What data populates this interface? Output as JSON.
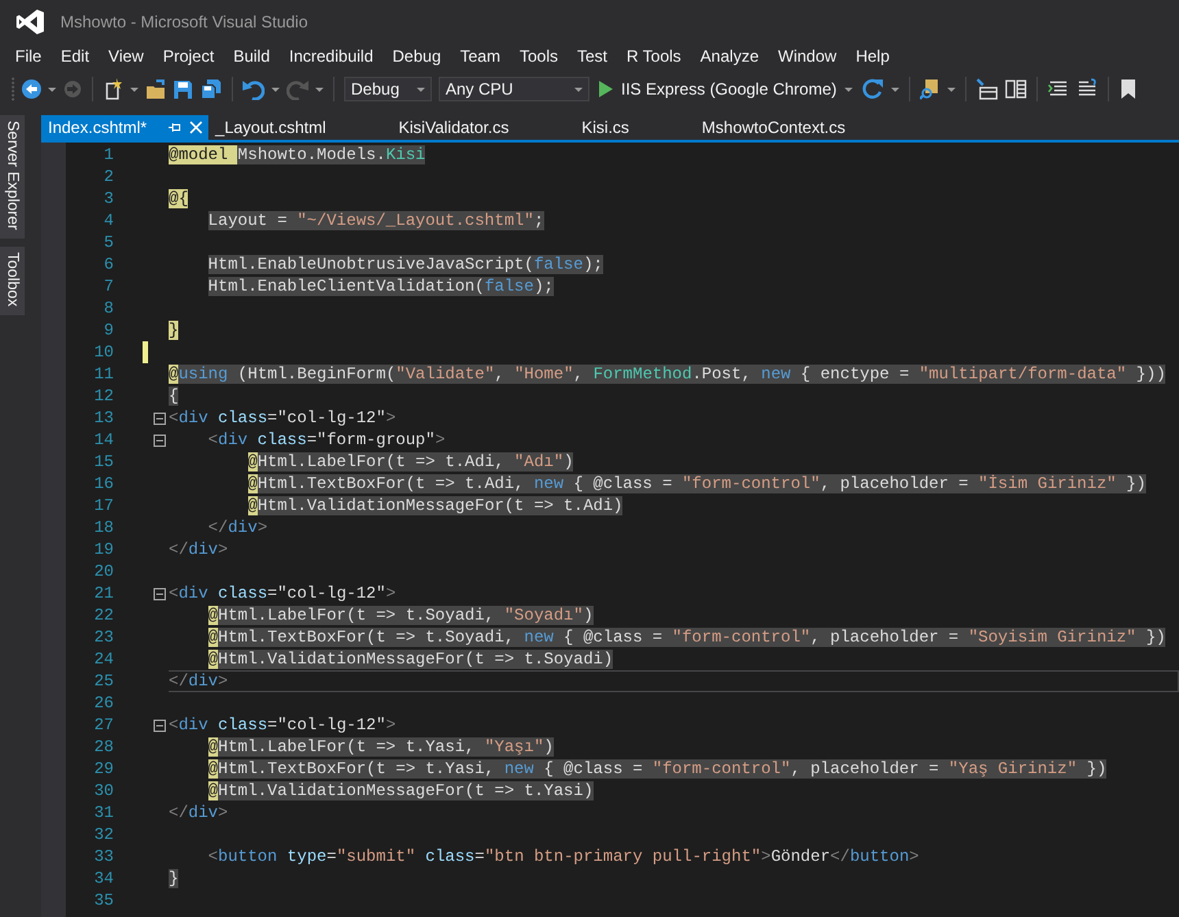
{
  "window": {
    "title": "Mshowto - Microsoft Visual Studio"
  },
  "menu": [
    "File",
    "Edit",
    "View",
    "Project",
    "Build",
    "Incredibuild",
    "Debug",
    "Team",
    "Tools",
    "Test",
    "R Tools",
    "Analyze",
    "Window",
    "Help"
  ],
  "toolbar": {
    "configuration": "Debug",
    "platform": "Any CPU",
    "run_target": "IIS Express (Google Chrome)"
  },
  "side_tabs": [
    "Server Explorer",
    "Toolbox"
  ],
  "tabs": [
    {
      "label": "Index.cshtml*",
      "selected": true
    },
    {
      "label": "_Layout.cshtml",
      "selected": false
    },
    {
      "label": "KisiValidator.cs",
      "selected": false
    },
    {
      "label": "Kisi.cs",
      "selected": false
    },
    {
      "label": "MshowtoContext.cs",
      "selected": false
    }
  ],
  "editor": {
    "lines": [
      {
        "number": "1",
        "tokens": [
          {
            "kind": "r",
            "text": "@model "
          },
          {
            "kind": "p",
            "text": "Mshowto.Models."
          },
          {
            "kind": "t",
            "text": "Kisi"
          }
        ],
        "highlighted": true,
        "modified": false,
        "current": false,
        "foldable": false
      },
      {
        "number": "2",
        "highlighted": false,
        "modified": false,
        "current": false,
        "foldable": false
      },
      {
        "number": "3",
        "tokens": [
          {
            "kind": "r",
            "text": "@{"
          }
        ],
        "highlighted": false,
        "modified": false,
        "current": false,
        "foldable": false,
        "children": [
          {
            "number": "4",
            "tokens": [
              {
                "kind": "p",
                "text": "Layout = "
              },
              {
                "kind": "s",
                "text": "\"~/Views/_Layout.cshtml\""
              },
              {
                "kind": "p",
                "text": ";"
              }
            ],
            "highlighted": true,
            "modified": false,
            "current": false,
            "foldable": false
          },
          {
            "number": "5",
            "highlighted": false,
            "modified": false,
            "current": false,
            "foldable": false
          },
          {
            "number": "6",
            "tokens": [
              {
                "kind": "p",
                "text": "Html.EnableUnobtrusiveJavaScript("
              },
              {
                "kind": "k",
                "text": "false"
              },
              {
                "kind": "p",
                "text": ");"
              }
            ],
            "highlighted": true,
            "modified": false,
            "current": false,
            "foldable": false
          },
          {
            "number": "7",
            "tokens": [
              {
                "kind": "p",
                "text": "Html.EnableClientValidation("
              },
              {
                "kind": "k",
                "text": "false"
              },
              {
                "kind": "p",
                "text": ");"
              }
            ],
            "highlighted": true,
            "modified": false,
            "current": false,
            "foldable": false
          },
          {
            "number": "8",
            "highlighted": false,
            "modified": false,
            "current": false,
            "foldable": false
          }
        ]
      },
      {
        "number": "9",
        "tokens": [
          {
            "kind": "r",
            "text": "}"
          }
        ],
        "highlighted": false,
        "modified": false,
        "current": false,
        "foldable": false
      },
      {
        "number": "10",
        "highlighted": false,
        "modified": true,
        "current": false,
        "foldable": false
      },
      {
        "number": "11",
        "tokens": [
          {
            "kind": "r",
            "text": "@"
          },
          {
            "kind": "k",
            "text": "using"
          },
          {
            "kind": "p",
            "text": " (Html.BeginForm("
          },
          {
            "kind": "s",
            "text": "\"Validate\""
          },
          {
            "kind": "p",
            "text": ", "
          },
          {
            "kind": "s",
            "text": "\"Home\""
          },
          {
            "kind": "p",
            "text": ", "
          },
          {
            "kind": "t",
            "text": "FormMethod"
          },
          {
            "kind": "p",
            "text": ".Post, "
          },
          {
            "kind": "k",
            "text": "new"
          },
          {
            "kind": "p",
            "text": " { enctype = "
          },
          {
            "kind": "s",
            "text": "\"multipart/form-data\""
          },
          {
            "kind": "p",
            "text": " }))"
          }
        ],
        "highlighted": true,
        "modified": false,
        "current": false,
        "foldable": false
      },
      {
        "number": "12",
        "tokens": [
          {
            "kind": "p",
            "text": "{"
          }
        ],
        "highlighted": true,
        "modified": false,
        "current": false,
        "foldable": false
      },
      {
        "number": "13",
        "tokens": [
          {
            "kind": "g",
            "text": "<"
          },
          {
            "kind": "k",
            "text": "div"
          },
          {
            "kind": "a",
            "text": " class"
          },
          {
            "kind": "p",
            "text": "=\"col-lg-12\""
          },
          {
            "kind": "g",
            "text": ">"
          }
        ],
        "highlighted": false,
        "modified": false,
        "current": false,
        "foldable": true,
        "children": [
          {
            "number": "14",
            "tokens": [
              {
                "kind": "g",
                "text": "<"
              },
              {
                "kind": "k",
                "text": "div"
              },
              {
                "kind": "a",
                "text": " class"
              },
              {
                "kind": "p",
                "text": "=\"form-group\""
              },
              {
                "kind": "g",
                "text": ">"
              }
            ],
            "highlighted": false,
            "modified": false,
            "current": false,
            "foldable": true,
            "children": [
              {
                "number": "15",
                "tokens": [
                  {
                    "kind": "r",
                    "text": "@"
                  },
                  {
                    "kind": "p",
                    "text": "Html.LabelFor(t => t.Adi, "
                  },
                  {
                    "kind": "s",
                    "text": "\"Adı\""
                  },
                  {
                    "kind": "p",
                    "text": ")"
                  }
                ],
                "highlighted": true,
                "modified": false,
                "current": false,
                "foldable": false
              },
              {
                "number": "16",
                "tokens": [
                  {
                    "kind": "r",
                    "text": "@"
                  },
                  {
                    "kind": "p",
                    "text": "Html.TextBoxFor(t => t.Adi, "
                  },
                  {
                    "kind": "k",
                    "text": "new"
                  },
                  {
                    "kind": "p",
                    "text": " { @class = "
                  },
                  {
                    "kind": "s",
                    "text": "\"form-control\""
                  },
                  {
                    "kind": "p",
                    "text": ", placeholder = "
                  },
                  {
                    "kind": "s",
                    "text": "\"İsim Giriniz\""
                  },
                  {
                    "kind": "p",
                    "text": " })"
                  }
                ],
                "highlighted": true,
                "modified": false,
                "current": false,
                "foldable": false
              },
              {
                "number": "17",
                "tokens": [
                  {
                    "kind": "r",
                    "text": "@"
                  },
                  {
                    "kind": "p",
                    "text": "Html.ValidationMessageFor(t => t.Adi)"
                  }
                ],
                "highlighted": true,
                "modified": false,
                "current": false,
                "foldable": false
              }
            ]
          },
          {
            "number": "18",
            "tokens": [
              {
                "kind": "g",
                "text": "</"
              },
              {
                "kind": "k",
                "text": "div"
              },
              {
                "kind": "g",
                "text": ">"
              }
            ],
            "highlighted": false,
            "modified": false,
            "current": false,
            "foldable": false
          }
        ]
      },
      {
        "number": "19",
        "tokens": [
          {
            "kind": "g",
            "text": "</"
          },
          {
            "kind": "k",
            "text": "div"
          },
          {
            "kind": "g",
            "text": ">"
          }
        ],
        "highlighted": false,
        "modified": false,
        "current": false,
        "foldable": false
      },
      {
        "number": "20",
        "highlighted": false,
        "modified": false,
        "current": false,
        "foldable": false
      },
      {
        "number": "21",
        "tokens": [
          {
            "kind": "g",
            "text": "<"
          },
          {
            "kind": "k",
            "text": "div"
          },
          {
            "kind": "a",
            "text": " class"
          },
          {
            "kind": "p",
            "text": "=\"col-lg-12\""
          },
          {
            "kind": "g",
            "text": ">"
          }
        ],
        "highlighted": false,
        "modified": false,
        "current": false,
        "foldable": true,
        "children": [
          {
            "number": "22",
            "tokens": [
              {
                "kind": "r",
                "text": "@"
              },
              {
                "kind": "p",
                "text": "Html.LabelFor(t => t.Soyadi, "
              },
              {
                "kind": "s",
                "text": "\"Soyadı\""
              },
              {
                "kind": "p",
                "text": ")"
              }
            ],
            "highlighted": true,
            "modified": false,
            "current": false,
            "foldable": false
          },
          {
            "number": "23",
            "tokens": [
              {
                "kind": "r",
                "text": "@"
              },
              {
                "kind": "p",
                "text": "Html.TextBoxFor(t => t.Soyadi, "
              },
              {
                "kind": "k",
                "text": "new"
              },
              {
                "kind": "p",
                "text": " { @class = "
              },
              {
                "kind": "s",
                "text": "\"form-control\""
              },
              {
                "kind": "p",
                "text": ", placeholder = "
              },
              {
                "kind": "s",
                "text": "\"Soyisim Giriniz\""
              },
              {
                "kind": "p",
                "text": " })"
              }
            ],
            "highlighted": true,
            "modified": false,
            "current": false,
            "foldable": false
          },
          {
            "number": "24",
            "tokens": [
              {
                "kind": "r",
                "text": "@"
              },
              {
                "kind": "p",
                "text": "Html.ValidationMessageFor(t => t.Soyadi)"
              }
            ],
            "highlighted": true,
            "modified": false,
            "current": false,
            "foldable": false
          }
        ]
      },
      {
        "number": "25",
        "tokens": [
          {
            "kind": "g",
            "text": "</"
          },
          {
            "kind": "k",
            "text": "div"
          },
          {
            "kind": "g",
            "text": ">"
          }
        ],
        "highlighted": false,
        "modified": false,
        "current": true,
        "foldable": false
      },
      {
        "number": "26",
        "highlighted": false,
        "modified": false,
        "current": false,
        "foldable": false
      },
      {
        "number": "27",
        "tokens": [
          {
            "kind": "g",
            "text": "<"
          },
          {
            "kind": "k",
            "text": "div"
          },
          {
            "kind": "a",
            "text": " class"
          },
          {
            "kind": "p",
            "text": "=\"col-lg-12\""
          },
          {
            "kind": "g",
            "text": ">"
          }
        ],
        "highlighted": false,
        "modified": false,
        "current": false,
        "foldable": true,
        "children": [
          {
            "number": "28",
            "tokens": [
              {
                "kind": "r",
                "text": "@"
              },
              {
                "kind": "p",
                "text": "Html.LabelFor(t => t.Yasi, "
              },
              {
                "kind": "s",
                "text": "\"Yaşı\""
              },
              {
                "kind": "p",
                "text": ")"
              }
            ],
            "highlighted": true,
            "modified": false,
            "current": false,
            "foldable": false
          },
          {
            "number": "29",
            "tokens": [
              {
                "kind": "r",
                "text": "@"
              },
              {
                "kind": "p",
                "text": "Html.TextBoxFor(t => t.Yasi, "
              },
              {
                "kind": "k",
                "text": "new"
              },
              {
                "kind": "p",
                "text": " { @class = "
              },
              {
                "kind": "s",
                "text": "\"form-control\""
              },
              {
                "kind": "p",
                "text": ", placeholder = "
              },
              {
                "kind": "s",
                "text": "\"Yaş Giriniz\""
              },
              {
                "kind": "p",
                "text": " })"
              }
            ],
            "highlighted": true,
            "modified": false,
            "current": false,
            "foldable": false
          },
          {
            "number": "30",
            "tokens": [
              {
                "kind": "r",
                "text": "@"
              },
              {
                "kind": "p",
                "text": "Html.ValidationMessageFor(t => t.Yasi)"
              }
            ],
            "highlighted": true,
            "modified": false,
            "current": false,
            "foldable": false
          }
        ]
      },
      {
        "number": "31",
        "tokens": [
          {
            "kind": "g",
            "text": "</"
          },
          {
            "kind": "k",
            "text": "div"
          },
          {
            "kind": "g",
            "text": ">"
          }
        ],
        "highlighted": false,
        "modified": false,
        "current": false,
        "foldable": false
      },
      {
        "number": "32",
        "highlighted": false,
        "modified": false,
        "current": false,
        "foldable": false,
        "children": [
          {
            "number": "33",
            "tokens": [
              {
                "kind": "g",
                "text": "<"
              },
              {
                "kind": "k",
                "text": "button"
              },
              {
                "kind": "a",
                "text": " type"
              },
              {
                "kind": "p",
                "text": "="
              },
              {
                "kind": "s",
                "text": "\"submit\""
              },
              {
                "kind": "a",
                "text": " class"
              },
              {
                "kind": "p",
                "text": "="
              },
              {
                "kind": "s",
                "text": "\"btn btn-primary pull-right\""
              },
              {
                "kind": "g",
                "text": ">"
              },
              {
                "kind": "p",
                "text": "Gönder"
              },
              {
                "kind": "g",
                "text": "</"
              },
              {
                "kind": "k",
                "text": "button"
              },
              {
                "kind": "g",
                "text": ">"
              }
            ],
            "highlighted": false,
            "modified": false,
            "current": false,
            "foldable": false
          }
        ]
      },
      {
        "number": "34",
        "tokens": [
          {
            "kind": "p",
            "text": "}"
          }
        ],
        "highlighted": true,
        "modified": false,
        "current": false,
        "foldable": false
      },
      {
        "number": "35",
        "highlighted": false,
        "modified": false,
        "current": false,
        "foldable": false
      }
    ]
  }
}
